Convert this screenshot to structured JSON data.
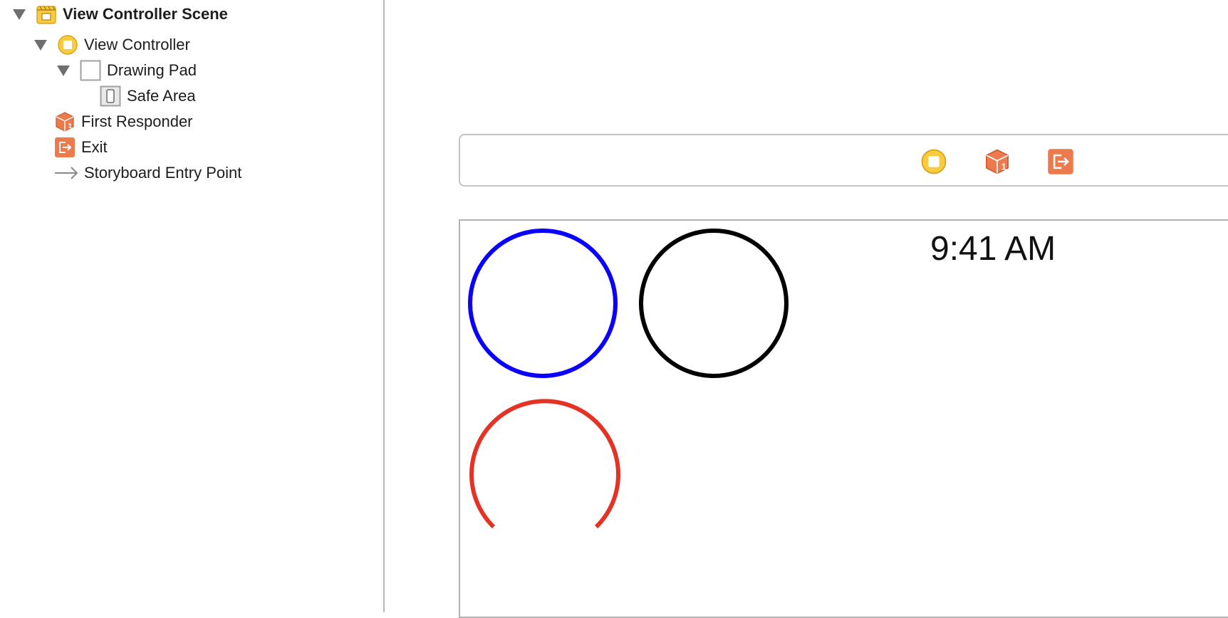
{
  "outline": {
    "scene": {
      "label": "View Controller Scene",
      "icon": "storyboard-scene-icon"
    },
    "view_controller": {
      "label": "View Controller",
      "icon": "view-controller-icon"
    },
    "drawing_pad": {
      "label": "Drawing Pad",
      "icon": "view-icon"
    },
    "safe_area": {
      "label": "Safe Area",
      "icon": "safe-area-icon"
    },
    "first_responder": {
      "label": "First Responder",
      "icon": "first-responder-cube-icon"
    },
    "exit": {
      "label": "Exit",
      "icon": "exit-icon"
    },
    "entry_point": {
      "label": "Storyboard Entry Point",
      "icon": "arrow-right-icon"
    }
  },
  "scene_dock": {
    "icons": [
      "view-controller-icon",
      "first-responder-cube-icon",
      "exit-icon"
    ]
  },
  "device": {
    "status_time": "9:41 AM"
  },
  "shapes": [
    {
      "name": "blue-circle",
      "kind": "circle",
      "color": "#0a00ff"
    },
    {
      "name": "black-circle",
      "kind": "circle",
      "color": "#000000"
    },
    {
      "name": "red-arc",
      "kind": "arc",
      "color": "#e53224"
    }
  ],
  "colors": {
    "accent_orange": "#ec7a4d",
    "vc_yellow": "#f9cc3f",
    "divider": "#b9b9b9"
  }
}
